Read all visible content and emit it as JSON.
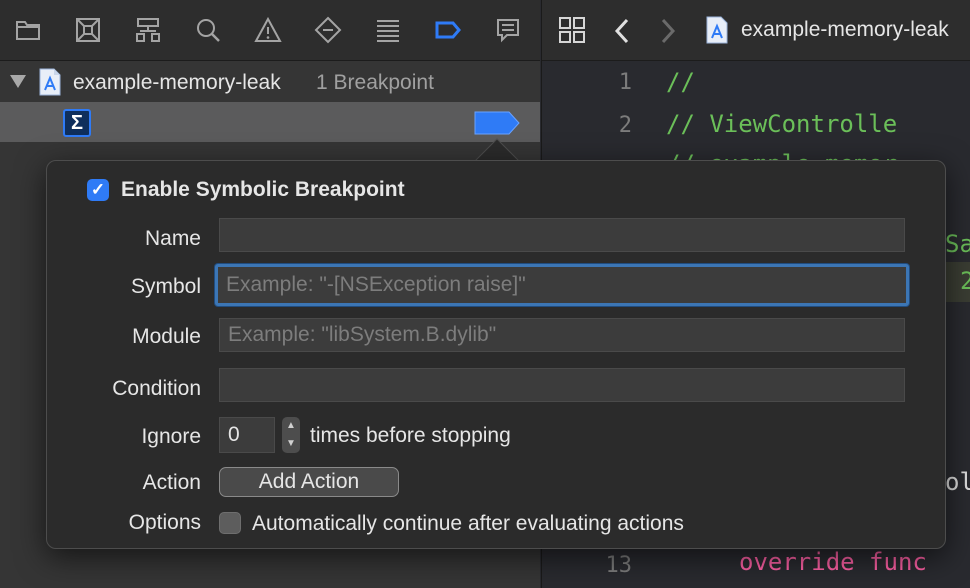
{
  "navigator": {
    "toolbar_icons": [
      "folder-icon",
      "source-control-icon",
      "hierarchy-icon",
      "search-icon",
      "warning-icon",
      "test-icon",
      "debug-icon",
      "breakpoint-icon",
      "report-icon"
    ],
    "project_name": "example-memory-leak",
    "breakpoint_count": "1 Breakpoint"
  },
  "editor": {
    "file_name": "example-memory-leak",
    "lines": [
      {
        "num": "1",
        "code": "//"
      },
      {
        "num": "2",
        "code": "//  ViewControlle"
      },
      {
        "num": "",
        "code": "//  example-memor"
      },
      {
        "num": "13",
        "code": "override func"
      }
    ],
    "partial_fragments": [
      "Sa",
      "2",
      "ol"
    ]
  },
  "popover": {
    "enable_label": "Enable Symbolic Breakpoint",
    "enabled": true,
    "name_label": "Name",
    "name_value": "",
    "symbol_label": "Symbol",
    "symbol_placeholder": "Example: \"-[NSException raise]\"",
    "module_label": "Module",
    "module_placeholder": "Example: \"libSystem.B.dylib\"",
    "condition_label": "Condition",
    "ignore_label": "Ignore",
    "ignore_value": "0",
    "ignore_suffix": "times before stopping",
    "action_label": "Action",
    "add_action_label": "Add Action",
    "options_label": "Options",
    "options_text": "Automatically continue after evaluating actions",
    "options_checked": false
  },
  "colors": {
    "accent": "#2f7bf6",
    "comment": "#6bbf59",
    "keyword": "#fc5fa3"
  }
}
